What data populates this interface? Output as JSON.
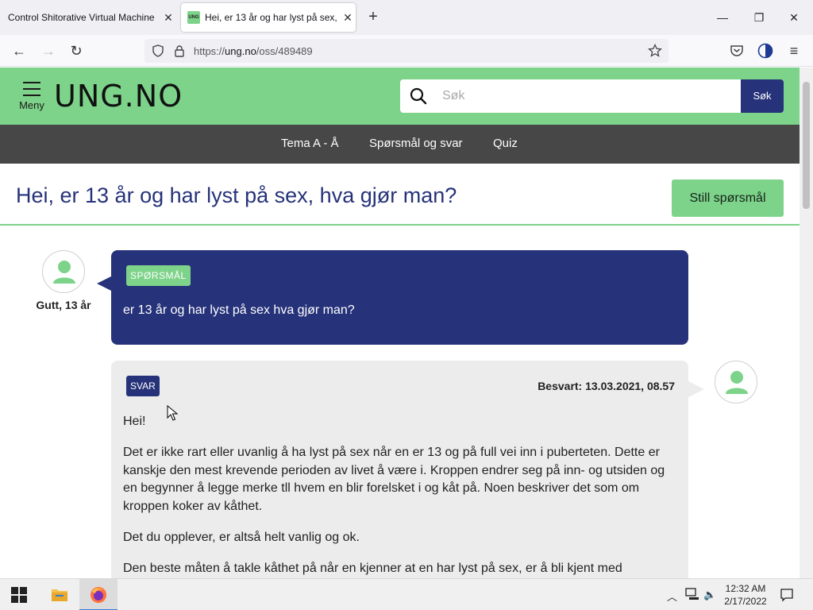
{
  "browser": {
    "tabs": [
      {
        "title": "Control Shitorative Virtual Machine",
        "active": false
      },
      {
        "title": "Hei, er 13 år og har lyst på sex, h",
        "active": true,
        "favicon_text": "UNG"
      }
    ],
    "url_prefix": "https://",
    "url_host": "ung.no",
    "url_path": "/oss/489489"
  },
  "site": {
    "menu_label": "Meny",
    "logo": "UNG.NO",
    "search_placeholder": "Søk",
    "search_button": "Søk",
    "nav": [
      "Tema A - Å",
      "Spørsmål og svar",
      "Quiz"
    ],
    "page_title": "Hei, er 13 år og har lyst på sex, hva gjør man?",
    "ask_button": "Still spørsmål"
  },
  "question": {
    "tag": "SPØRSMÅL",
    "author": "Gutt, 13 år",
    "text": "er 13 år og har lyst på sex hva gjør man?"
  },
  "answer": {
    "tag": "SVAR",
    "answered": "Besvart: 13.03.2021, 08.57",
    "paragraphs": [
      "Hei!",
      "Det er ikke rart eller uvanlig å ha lyst på sex når en er 13 og på full vei inn i puberteten. Dette er kanskje den mest krevende perioden av livet å være i. Kroppen endrer seg på inn- og utsiden og en begynner å legge merke tll hvem en blir forelsket i og kåt på. Noen beskriver det som om kroppen koker av kåthet.",
      "Det du opplever, er altså helt vanlig og ok.",
      "Den beste måten å takle kåthet på når en kjenner at en har lyst på sex, er å bli kjent med"
    ]
  },
  "taskbar": {
    "time": "12:32 AM",
    "date": "2/17/2022"
  },
  "colors": {
    "brand_green": "#7dd38a",
    "brand_navy": "#263279",
    "nav_gray": "#474747"
  }
}
